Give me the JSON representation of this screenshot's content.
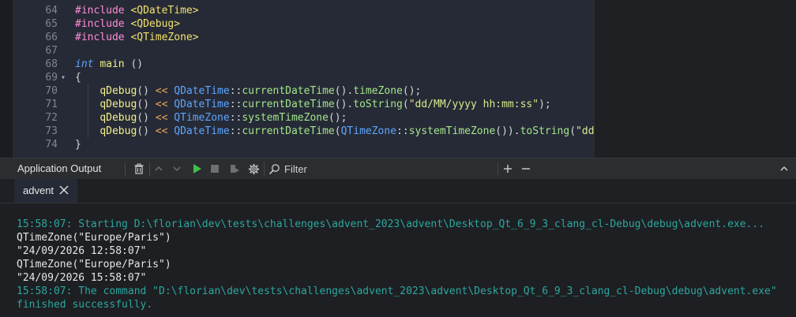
{
  "editor": {
    "lines": [
      {
        "num": "64",
        "text": "#include <QDateTime>"
      },
      {
        "num": "65",
        "text": "#include <QDebug>"
      },
      {
        "num": "66",
        "text": "#include <QTimeZone>"
      },
      {
        "num": "67",
        "text": ""
      },
      {
        "num": "68",
        "text": "int main ()"
      },
      {
        "num": "69",
        "text": "{"
      },
      {
        "num": "70",
        "text": "qDebug() << QDateTime::currentDateTime().timeZone();"
      },
      {
        "num": "71",
        "text": "qDebug() << QDateTime::currentDateTime().toString(\"dd/MM/yyyy hh:mm:ss\");"
      },
      {
        "num": "72",
        "text": "qDebug() << QTimeZone::systemTimeZone();"
      },
      {
        "num": "73",
        "text": "qDebug() << QDateTime::currentDateTime(QTimeZone::systemTimeZone()).toString(\"dd/MM/yyyy hh:mm:ss\");"
      },
      {
        "num": "74",
        "text": "}"
      }
    ]
  },
  "output_pane": {
    "title": "Application Output",
    "filter_label": "Filter",
    "tab": {
      "label": "advent"
    },
    "lines": [
      {
        "kind": "sys",
        "text": "15:58:07: Starting D:\\florian\\dev\\tests\\challenges\\advent_2023\\advent\\Desktop_Qt_6_9_3_clang_cl-Debug\\debug\\advent.exe..."
      },
      {
        "kind": "std",
        "text": "QTimeZone(\"Europe/Paris\")"
      },
      {
        "kind": "std",
        "text": "\"24/09/2026 12:58:07\""
      },
      {
        "kind": "std",
        "text": "QTimeZone(\"Europe/Paris\")"
      },
      {
        "kind": "std",
        "text": "\"24/09/2026 15:58:07\""
      },
      {
        "kind": "sys",
        "text": "15:58:07: The command \"D:\\florian\\dev\\tests\\challenges\\advent_2023\\advent\\Desktop_Qt_6_9_3_clang_cl-Debug\\debug\\advent.exe\""
      },
      {
        "kind": "sys",
        "text": "finished successfully."
      }
    ]
  },
  "icons": {
    "clear": "trash-icon",
    "prev": "chevron-up-icon",
    "next": "chevron-down-icon",
    "run": "run-icon",
    "stop": "stop-icon",
    "attach": "attach-debugger-icon",
    "settings": "gear-icon",
    "filter": "search-icon",
    "zoom_in": "plus-icon",
    "zoom_out": "minus-icon",
    "close_tab": "close-icon",
    "collapse": "chevron-up-icon"
  },
  "colors": {
    "editor_bg": "#262a36",
    "system_message": "#2ba7a0",
    "stdout": "#e6e6e6",
    "run_green": "#3fbf4a"
  }
}
